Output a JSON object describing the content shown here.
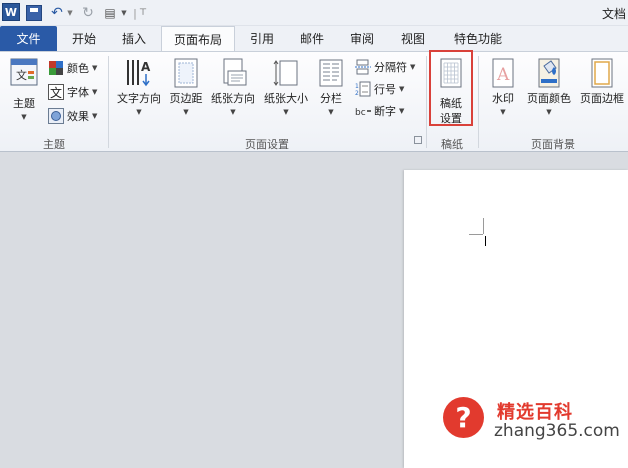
{
  "app": {
    "logo_letter": "W",
    "title": "文档"
  },
  "tabs": [
    {
      "label": "文件"
    },
    {
      "label": "开始"
    },
    {
      "label": "插入"
    },
    {
      "label": "页面布局"
    },
    {
      "label": "引用"
    },
    {
      "label": "邮件"
    },
    {
      "label": "审阅"
    },
    {
      "label": "视图"
    },
    {
      "label": "特色功能"
    }
  ],
  "ribbon": {
    "theme_group": {
      "label": "主题",
      "themes_btn": "主题",
      "colors_btn": "颜色",
      "fonts_btn": "字体",
      "effects_btn": "效果"
    },
    "page_setup_group": {
      "label": "页面设置",
      "text_direction": "文字方向",
      "margins": "页边距",
      "orientation": "纸张方向",
      "size": "纸张大小",
      "columns": "分栏",
      "breaks": "分隔符",
      "line_numbers": "行号",
      "hyphenation": "断字"
    },
    "manuscript_group": {
      "label": "稿纸",
      "btn_line1": "稿纸",
      "btn_line2": "设置"
    },
    "page_background_group": {
      "label": "页面背景",
      "watermark": "水印",
      "page_color": "页面颜色",
      "page_borders": "页面边框"
    }
  },
  "watermark": {
    "icon_glyph": "?",
    "name": "精选百科",
    "site": "zhang365.com",
    "color": "#e23a2e"
  },
  "colors": {
    "file_tab": "#2a5aa7",
    "highlight": "#d9413a"
  }
}
